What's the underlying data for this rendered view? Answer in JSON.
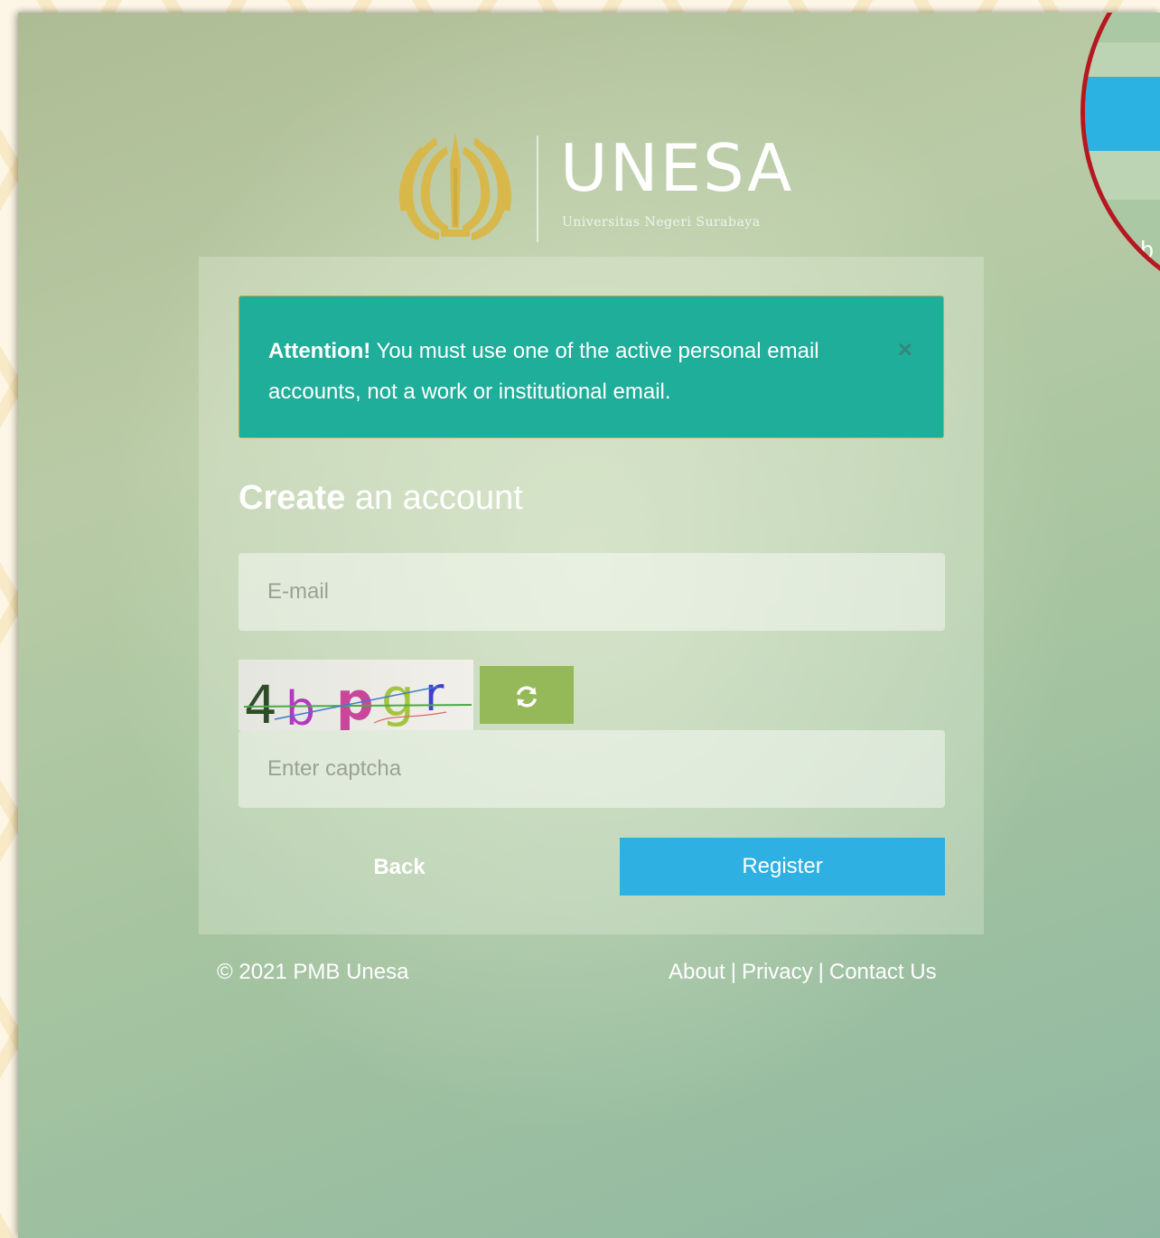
{
  "brand": {
    "title": "UNESA",
    "subtitle": "Universitas Negeri Surabaya"
  },
  "alert": {
    "strong": "Attention!",
    "message": " You must use one of the active personal email accounts, not a work or institutional email.",
    "close": "×"
  },
  "heading": {
    "strong": "Create",
    "rest": " an account"
  },
  "form": {
    "email_placeholder": "E-mail",
    "captcha_text": "4bpgr",
    "captcha_refresh_icon": "refresh-icon",
    "captcha_placeholder": "Enter captcha",
    "back_label": "Back",
    "register_label": "Register"
  },
  "footer": {
    "copyright": "© 2021 PMB Unesa",
    "links": [
      "About",
      "Privacy",
      "Contact Us"
    ],
    "separator": "|"
  },
  "zoom": {
    "text": "Ab"
  },
  "colors": {
    "alert": "#1fae9a",
    "register": "#2eb0e2",
    "refresh": "#95b858",
    "callout_ring": "#b51820"
  }
}
